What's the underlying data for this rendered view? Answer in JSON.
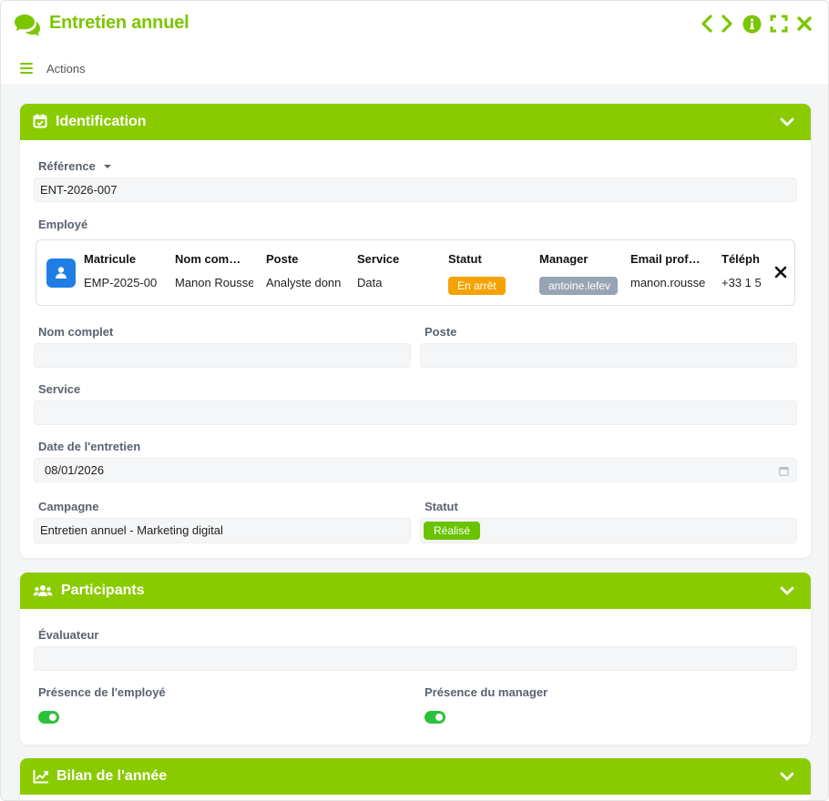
{
  "window": {
    "title": "Entretien annuel",
    "actions_label": "Actions",
    "accent_color": "#7bc600"
  },
  "identification": {
    "title": "Identification",
    "reference_label": "Référence",
    "reference_value": "ENT-2026-007",
    "employe_label": "Employé",
    "employe_table": {
      "headers": [
        "Matricule",
        "Nom com…",
        "Poste",
        "Service",
        "Statut",
        "Manager",
        "Email prof…",
        "Téléph"
      ],
      "values": [
        "EMP-2025-00",
        "Manon Rousse",
        "Analyste donn",
        "Data",
        "En arrêt",
        "antoine.lefev",
        "manon.rousse",
        "+33 1 5"
      ]
    },
    "nom_complet_label": "Nom complet",
    "nom_complet_value": "",
    "poste_label": "Poste",
    "poste_value": "",
    "service_label": "Service",
    "service_value": "",
    "date_label": "Date de l'entretien",
    "date_value": "08/01/2026",
    "campagne_label": "Campagne",
    "campagne_value": "Entretien annuel - Marketing digital",
    "statut_label": "Statut",
    "statut_value": "Réalisé"
  },
  "participants": {
    "title": "Participants",
    "evaluateur_label": "Évaluateur",
    "evaluateur_value": "",
    "presence_employe_label": "Présence de l'employé",
    "presence_employe_value": true,
    "presence_manager_label": "Présence du manager",
    "presence_manager_value": true
  },
  "bilan": {
    "title": "Bilan de l'année"
  }
}
